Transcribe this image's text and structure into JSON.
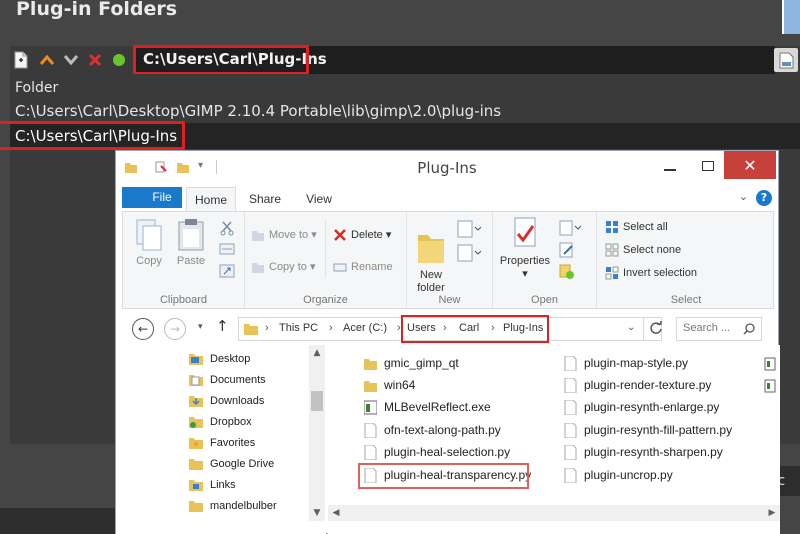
{
  "gimp": {
    "dialog_title": "Plug-in Folders",
    "path_entry_value": "C:\\Users\\Carl\\Plug-Ins",
    "list_header": "Folder",
    "folders": [
      "C:\\Users\\Carl\\Desktop\\GIMP 2.10.4 Portable\\lib\\gimp\\2.0\\plug-ins",
      "C:\\Users\\Carl\\Plug-Ins"
    ],
    "right_edge_text": "anc"
  },
  "explorer": {
    "title": "Plug-Ins",
    "tabs": [
      "File",
      "Home",
      "Share",
      "View"
    ],
    "help": "?",
    "ribbon": {
      "clipboard": {
        "label": "Clipboard",
        "copy": "Copy",
        "paste": "Paste"
      },
      "organize": {
        "label": "Organize",
        "move_to": "Move to",
        "copy_to": "Copy to",
        "delete": "Delete",
        "rename": "Rename"
      },
      "new": {
        "label": "New",
        "new_folder": "New\nfolder"
      },
      "open": {
        "label": "Open",
        "properties": "Properties"
      },
      "select": {
        "label": "Select",
        "select_all": "Select all",
        "select_none": "Select none",
        "invert": "Invert selection"
      }
    },
    "address": {
      "crumbs": [
        "This PC",
        "Acer (C:)",
        "Users",
        "Carl",
        "Plug-Ins"
      ],
      "search_placeholder": "Search ..."
    },
    "nav_items": [
      "Desktop",
      "Documents",
      "Downloads",
      "Dropbox",
      "Favorites",
      "Google Drive",
      "Links",
      "mandelbulber"
    ],
    "files_col1": [
      "gmic_gimp_qt",
      "win64",
      "MLBevelReflect.exe",
      "ofn-text-along-path.py",
      "plugin-heal-selection.py",
      "plugin-heal-transparency.py"
    ],
    "files_col2": [
      "plugin-map-style.py",
      "plugin-render-texture.py",
      "plugin-resynth-enlarge.py",
      "plugin-resynth-fill-pattern.py",
      "plugin-resynth-sharpen.py",
      "plugin-uncrop.py"
    ],
    "close_glyph": "✕"
  },
  "colors": {
    "gimp_bg": "#454545",
    "highlight_red": "#e02020",
    "ribbon_file_blue": "#1979ca",
    "close_red": "#c7403a",
    "folder_yellow": "#e8c35a"
  }
}
